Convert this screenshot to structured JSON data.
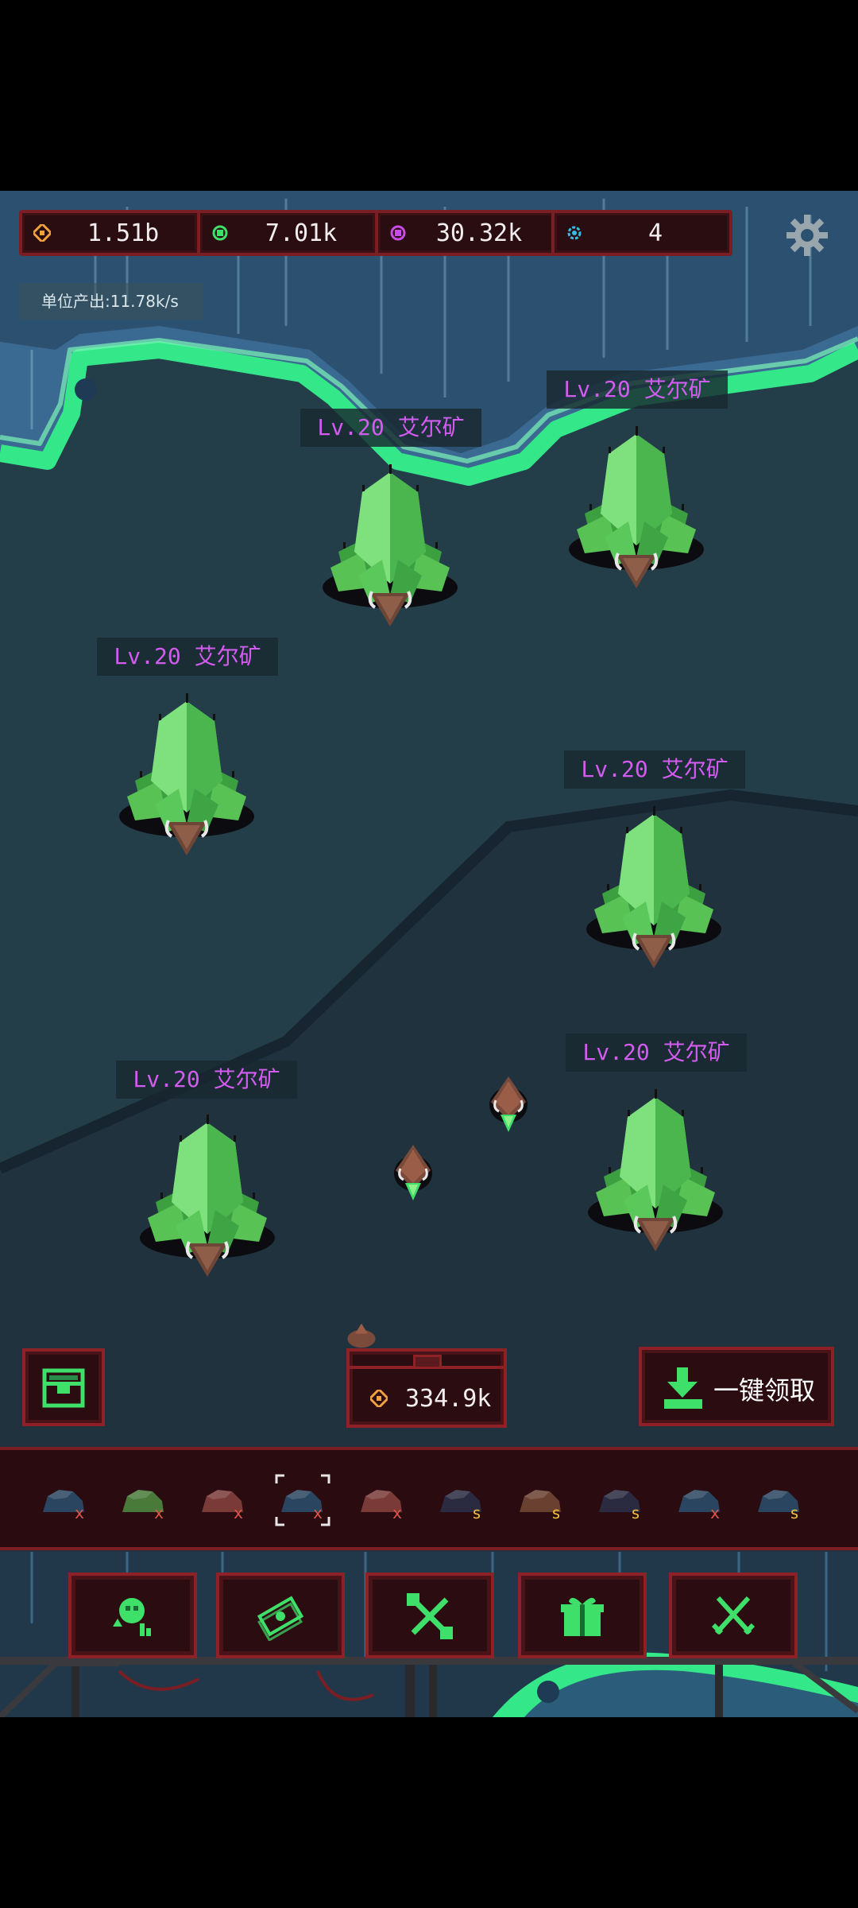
{
  "colors": {
    "gold": "#f0a13a",
    "green": "#3ee06a",
    "purple": "#c94be8",
    "cyan": "#36bde4",
    "label_text": "#d25cf0",
    "panel_border": "#8e2027",
    "panel_bg": "#2b0c10"
  },
  "resources": [
    {
      "icon": "gold-coin-icon",
      "value": "1.51b"
    },
    {
      "icon": "green-gem-icon",
      "value": "7.01k"
    },
    {
      "icon": "purple-gem-icon",
      "value": "30.32k"
    },
    {
      "icon": "blue-gear-icon",
      "value": "4"
    }
  ],
  "production_rate": "单位产出:11.78k/s",
  "mines": [
    {
      "label": "Lv.20 艾尔矿"
    },
    {
      "label": "Lv.20 艾尔矿"
    },
    {
      "label": "Lv.20 艾尔矿"
    },
    {
      "label": "Lv.20 艾尔矿"
    },
    {
      "label": "Lv.20 艾尔矿"
    },
    {
      "label": "Lv.20 艾尔矿"
    }
  ],
  "chest_value": "334.9k",
  "claim_all_label": "一键领取",
  "inventory_slot_count": 10,
  "nav_icons": [
    "upgrade-icon",
    "cash-icon",
    "tools-icon",
    "gift-icon",
    "battle-swords-icon"
  ]
}
